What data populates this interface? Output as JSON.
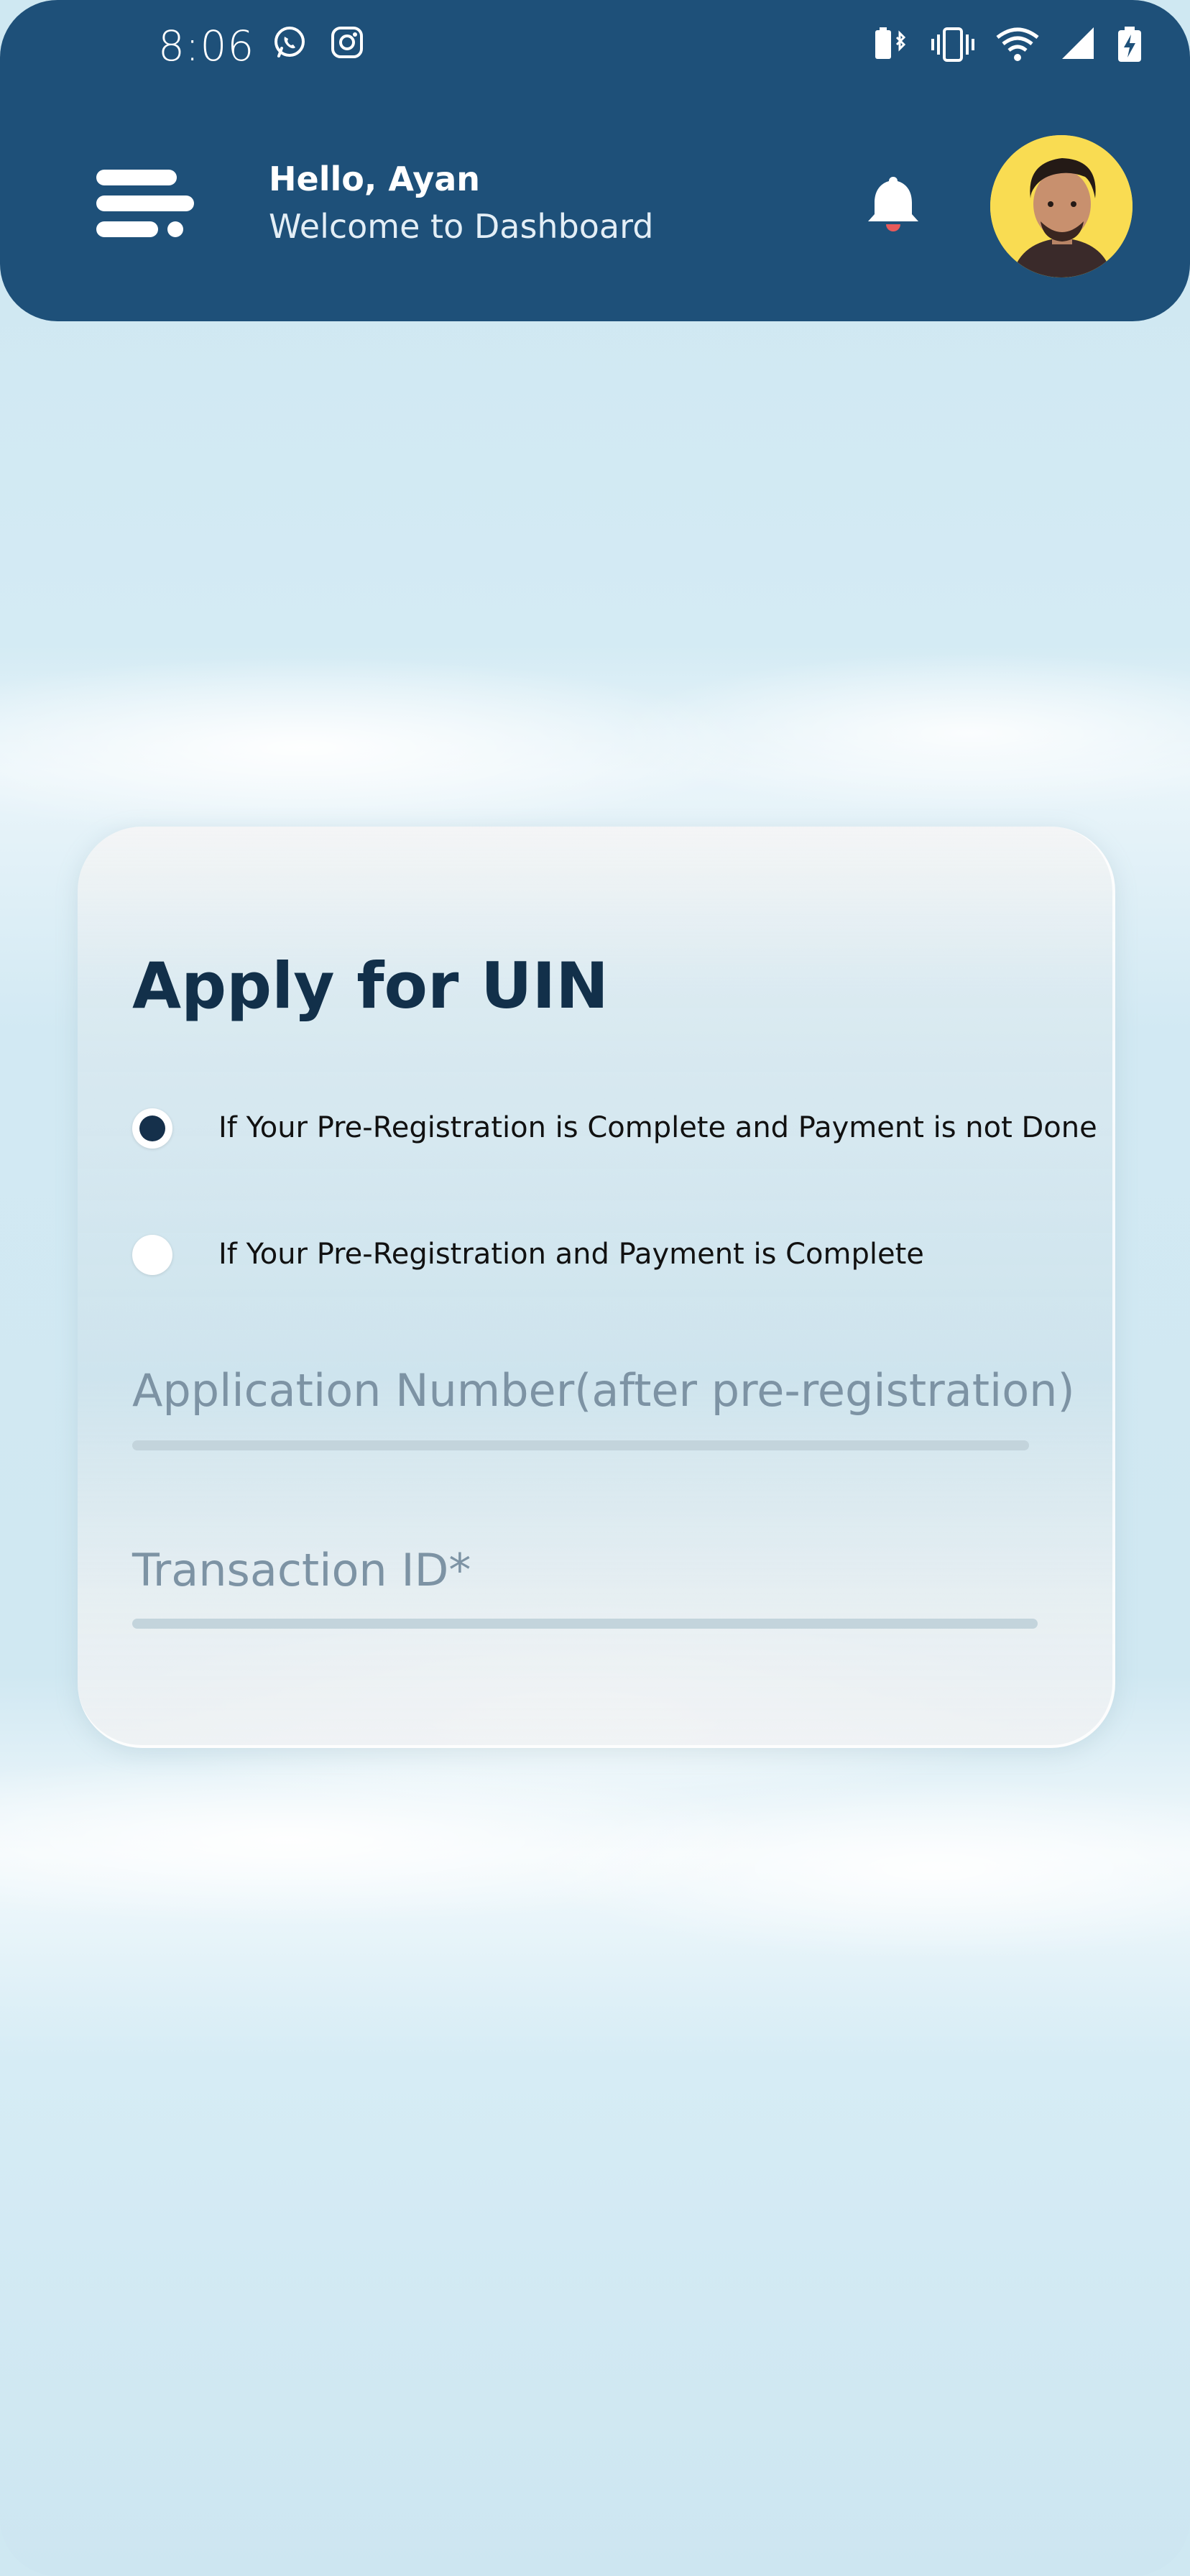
{
  "status_bar": {
    "time": "8:06",
    "left_icons": [
      "whatsapp-icon",
      "instagram-icon"
    ],
    "right_icons": [
      "bluetooth-battery-icon",
      "vibrate-icon",
      "wifi-icon",
      "signal-icon",
      "battery-charging-icon"
    ]
  },
  "header": {
    "greeting": "Hello, Ayan",
    "subtitle": "Welcome to Dashboard",
    "menu_icon": "menu-icon",
    "notification_icon": "bell-icon",
    "avatar_icon": "avatar",
    "colors": {
      "background": "#1e5079",
      "text": "#ffffff"
    }
  },
  "form": {
    "title": "Apply for UIN",
    "options": [
      {
        "label": "If Your Pre-Registration is Complete and Payment is not Done",
        "selected": true
      },
      {
        "label": "If Your Pre-Registration and Payment is Complete",
        "selected": false
      }
    ],
    "fields": [
      {
        "placeholder": "Application Number(after pre-registration)",
        "value": ""
      },
      {
        "placeholder": "Transaction ID*",
        "value": ""
      }
    ],
    "colors": {
      "title": "#12304a",
      "radio_selected": "#15304b",
      "placeholder": "#7d93a4"
    }
  }
}
